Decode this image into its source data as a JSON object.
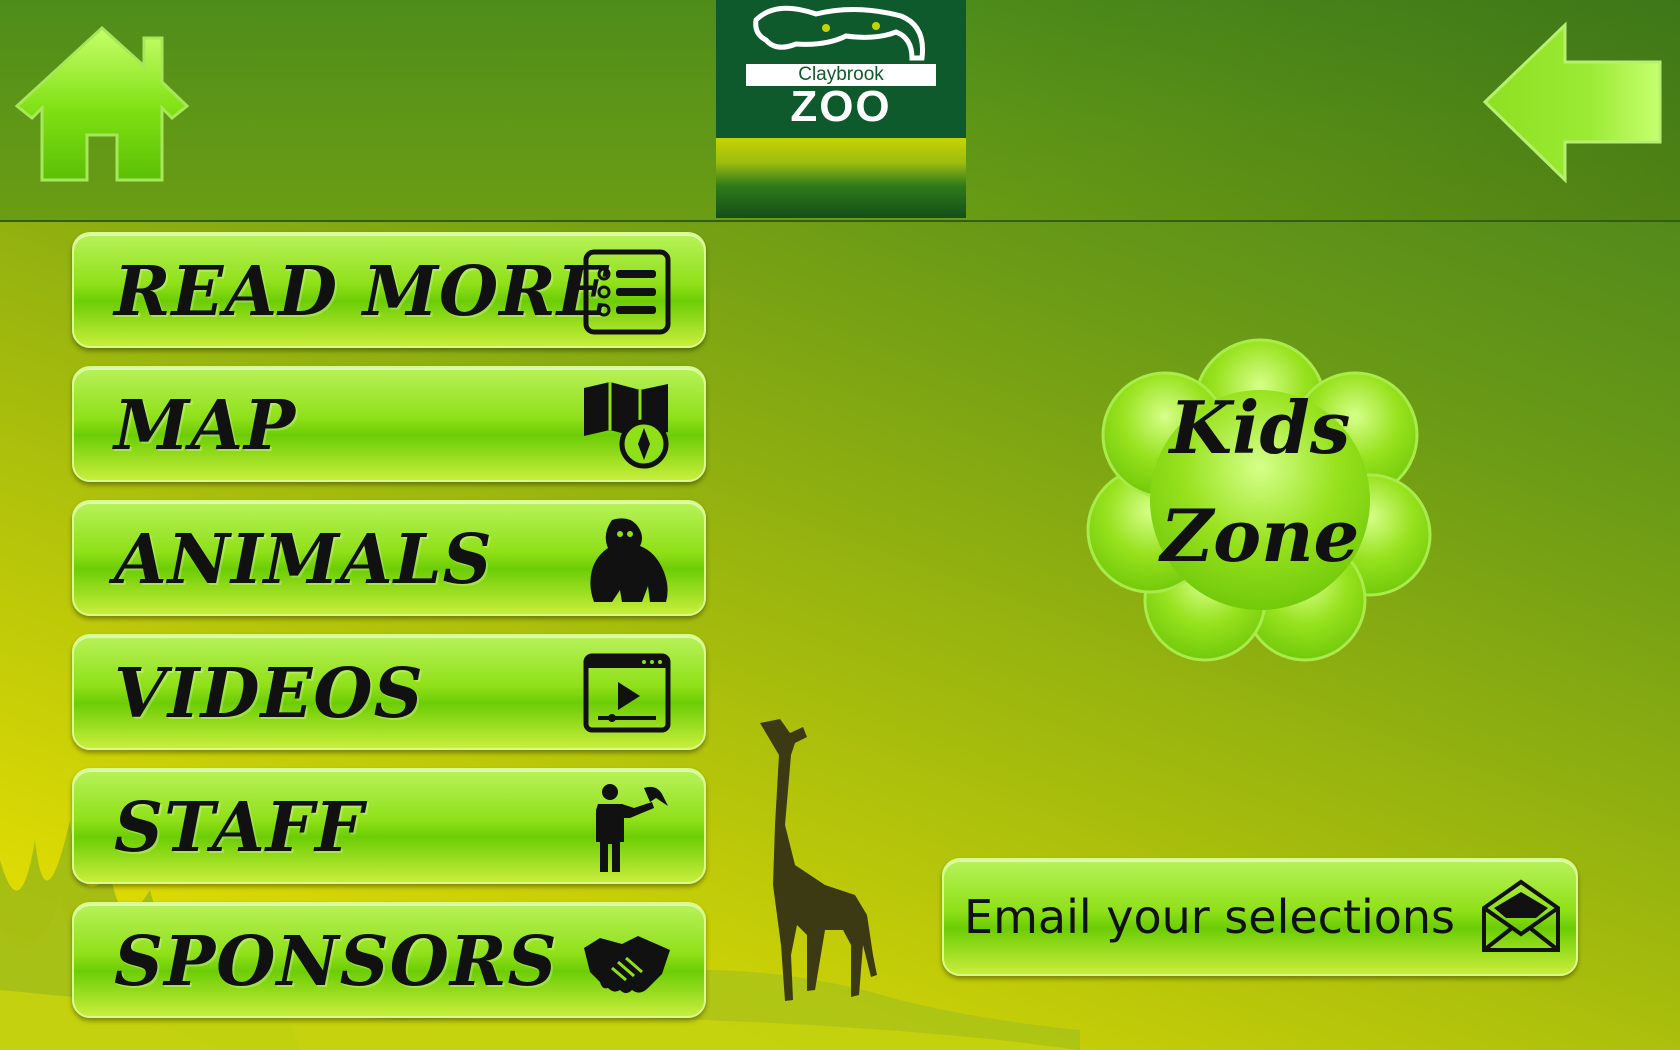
{
  "header": {
    "logo": {
      "line1": "Claybrook",
      "line2": "ZOO"
    }
  },
  "menu": {
    "items": [
      {
        "label": "READ MORE",
        "icon": "list-icon"
      },
      {
        "label": "MAP",
        "icon": "map-compass-icon"
      },
      {
        "label": "ANIMALS",
        "icon": "gorilla-icon"
      },
      {
        "label": "VIDEOS",
        "icon": "video-player-icon"
      },
      {
        "label": "STAFF",
        "icon": "keeper-with-parrot-icon"
      },
      {
        "label": "SPONSORS",
        "icon": "handshake-icon"
      }
    ]
  },
  "kids_zone": {
    "line1": "Kids",
    "line2": "Zone"
  },
  "email": {
    "label": "Email your selections",
    "icon": "envelope-icon"
  },
  "colors": {
    "button_green": "#8fe018",
    "header_green": "#5f9717",
    "logo_green": "#0f5a2c",
    "text_dark": "#111111"
  }
}
